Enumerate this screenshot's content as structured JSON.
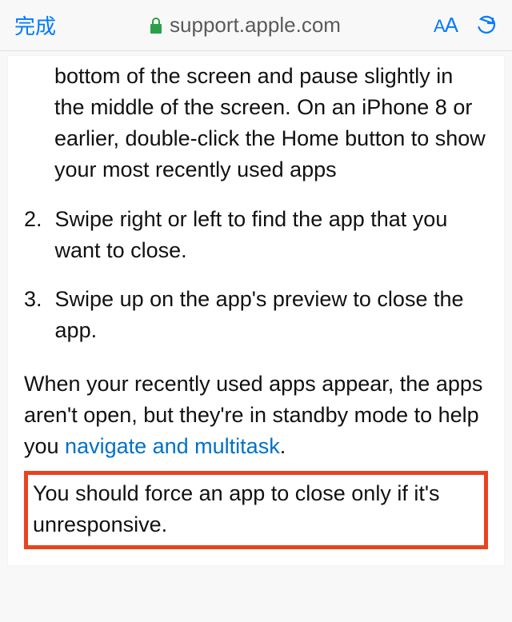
{
  "toolbar": {
    "done_label": "完成",
    "url": "support.apple.com",
    "text_size_small": "A",
    "text_size_big": "A"
  },
  "steps": {
    "s1": {
      "num": "",
      "text": "bottom of the screen and pause slightly in the middle of the screen. On an iPhone 8 or earlier, double-click the Home button to show your most recently used apps"
    },
    "s2": {
      "num": "2.",
      "text": "Swipe right or left to find the app that you want to close."
    },
    "s3": {
      "num": "3.",
      "text": "Swipe up on the app's preview to close the app."
    }
  },
  "paragraph": {
    "part1": "When your recently used apps appear, the apps aren't open, but they're in standby mode to help you ",
    "link_text": "navigate and multitask",
    "part2": "."
  },
  "highlight_text": "You should force an app to close only if it's unresponsive."
}
